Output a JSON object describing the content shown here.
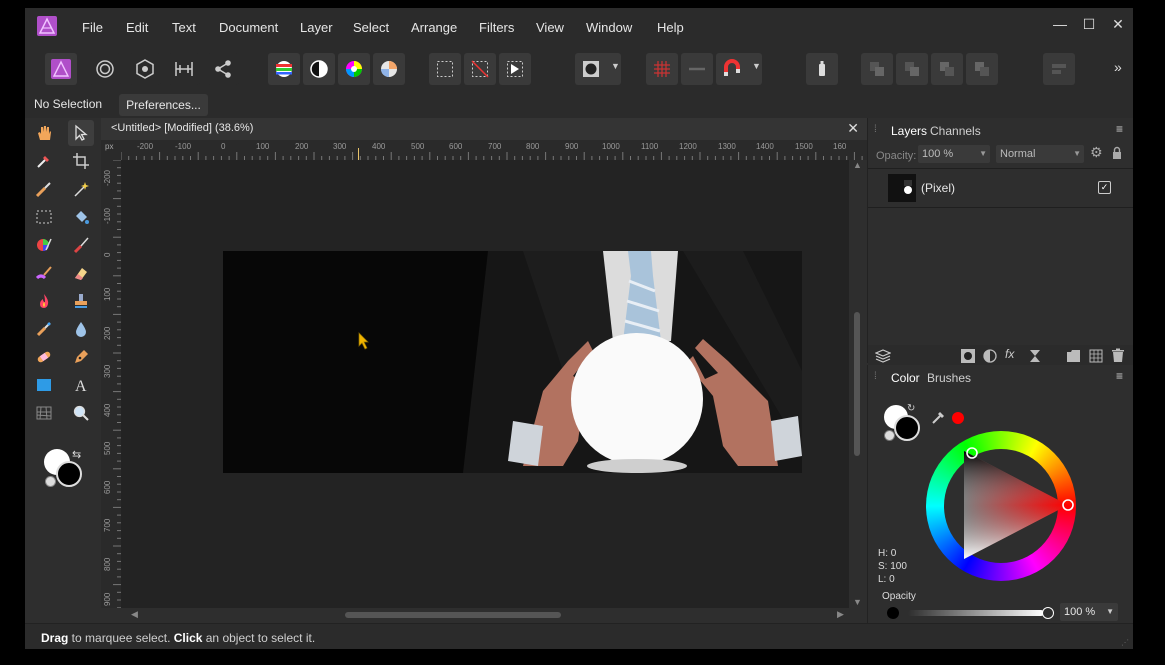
{
  "app": {
    "name": "Affinity Photo"
  },
  "menu": {
    "items": [
      "File",
      "Edit",
      "Text",
      "Document",
      "Layer",
      "Select",
      "Arrange",
      "Filters",
      "View",
      "Window",
      "Help"
    ]
  },
  "window_controls": {
    "minimize": "—",
    "maximize": "☐",
    "close": "✕"
  },
  "toolbar": {
    "personas": [
      "photo-persona-icon",
      "liquify-persona-icon",
      "develop-persona-icon",
      "tone-mapping-persona-icon",
      "export-persona-icon"
    ],
    "adjust_buttons": [
      "auto-levels-icon",
      "auto-contrast-icon",
      "auto-colors-icon",
      "auto-white-balance-icon"
    ],
    "overflow": "»"
  },
  "context_bar": {
    "selection_label": "No Selection",
    "preferences_button": "Preferences..."
  },
  "document": {
    "tab_title": "<Untitled> [Modified] (38.6%)",
    "ruler_unit": "px",
    "h_ruler_labels": [
      "-200",
      "-100",
      "0",
      "100",
      "200",
      "300",
      "400",
      "500",
      "600",
      "700",
      "800",
      "900",
      "1000",
      "1100",
      "1200",
      "1300",
      "1400",
      "1500",
      "160"
    ],
    "v_ruler_labels": [
      "-200",
      "-100",
      "0",
      "100",
      "200",
      "300",
      "400",
      "500",
      "600",
      "700",
      "800",
      "900"
    ]
  },
  "layers_panel": {
    "tabs": [
      "Layers",
      "Channels"
    ],
    "opacity_label": "Opacity:",
    "opacity_value": "100 %",
    "blend_mode": "Normal",
    "layer_name": "(Pixel)",
    "layer_visible": true
  },
  "color_panel": {
    "tabs": [
      "Color",
      "Brushes"
    ],
    "h_label": "H: 0",
    "s_label": "S: 100",
    "l_label": "L: 0",
    "opacity_label": "Opacity",
    "opacity_value": "100 %",
    "accent": "#ff0000"
  },
  "status_bar": {
    "drag_word": "Drag",
    "drag_rest": " to marquee select. ",
    "click_word": "Click",
    "click_rest": " an object to select it."
  }
}
